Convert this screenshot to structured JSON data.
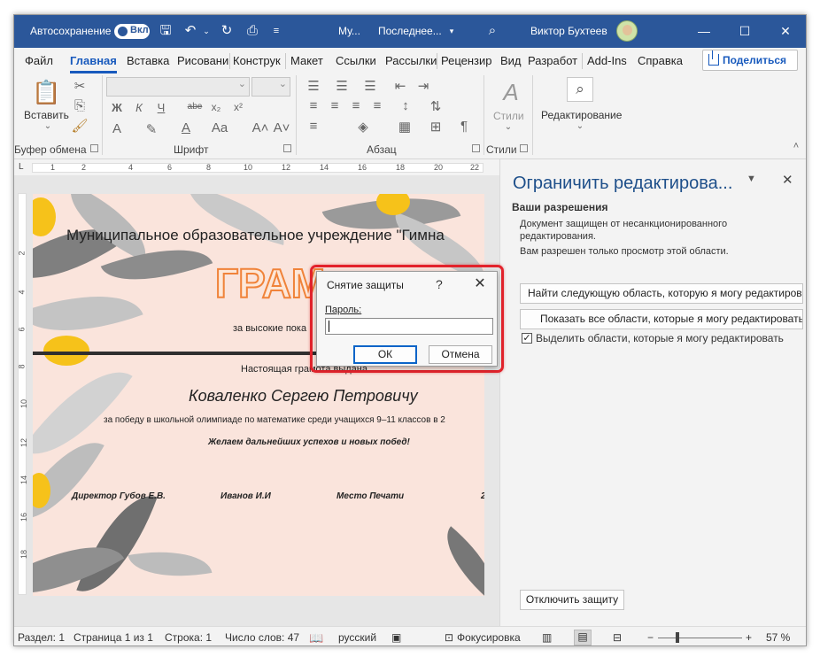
{
  "titlebar": {
    "autosave_label": "Автосохранение",
    "toggle_state": "Вкл",
    "doc_title": "Му...",
    "doc_status": "Последнее...",
    "user_name": "Виктор Бухтеев",
    "minimize": "—",
    "maximize": "☐",
    "close": "✕"
  },
  "tabs": [
    "Файл",
    "Главная",
    "Вставка",
    "Рисовани",
    "Конструк",
    "Макет",
    "Ссылки",
    "Рассылки",
    "Рецензир",
    "Вид",
    "Разработ",
    "Add-Ins",
    "Справка"
  ],
  "share_label": "Поделиться",
  "ribbon": {
    "paste_label": "Вставить",
    "clipboard_group": "Буфер обмена",
    "font_group": "Шрифт",
    "paragraph_group": "Абзац",
    "styles_group": "Стили",
    "styles_label": "Стили",
    "editing_label": "Редактирование",
    "bold": "Ж",
    "italic": "К",
    "underline": "Ч",
    "strike": "abe",
    "subscript": "x₂",
    "superscript": "x²",
    "pilcrow": "¶"
  },
  "hruler_ticks": [
    "1",
    "2",
    "4",
    "6",
    "8",
    "10",
    "12",
    "14",
    "16",
    "18",
    "20",
    "22"
  ],
  "vruler_ticks": [
    "2",
    "4",
    "6",
    "8",
    "10",
    "12",
    "14",
    "16",
    "18"
  ],
  "document": {
    "institution": "Муниципальное образовательное учреждение \"Гимна",
    "gramota": "ГРАМ",
    "subtitle": "за высокие пока",
    "issued_to": "Настоящая грамота выдана",
    "recipient": "Коваленко Сергею Петровичу",
    "reason": "за победу в школьной олимпиаде по математике среди учащихся 9–11 классов в 2",
    "wish": "Желаем дальнейших успехов и новых побед!",
    "sign1": "Директор Губов Е.В.",
    "sign2": "Иванов И.И",
    "sign3": "Место Печати",
    "sign4": "2"
  },
  "pane": {
    "title": "Ограничить редактирова...",
    "permissions_heading": "Ваши разрешения",
    "protected_line1": "Документ защищен от несанкционированного",
    "protected_line2": "редактирования.",
    "view_only": "Вам разрешен только просмотр этой области.",
    "find_next": "Найти следующую область, которую я могу редактировать",
    "show_all": "Показать все области, которые я могу редактировать",
    "highlight": "Выделить области, которые я могу редактировать",
    "highlight_checked": "✓",
    "stop_protection": "Отключить защиту"
  },
  "dialog": {
    "title": "Снятие защиты",
    "help": "?",
    "close": "✕",
    "password_label": "Пароль:",
    "password_value": "",
    "ok": "ОК",
    "cancel": "Отмена"
  },
  "status": {
    "section": "Раздел: 1",
    "page": "Страница 1 из 1",
    "line": "Строка: 1",
    "words": "Число слов: 47",
    "language": "русский",
    "focus": "Фокусировка",
    "zoom_minus": "−",
    "zoom_plus": "+",
    "zoom": "57 %"
  },
  "colors": {
    "accent": "#2b579a",
    "highlight_border": "#e3232c",
    "page_bg": "#fae4dc",
    "leaf_gray": "#8a8a8a",
    "leaf_yellow": "#f6c21a"
  }
}
